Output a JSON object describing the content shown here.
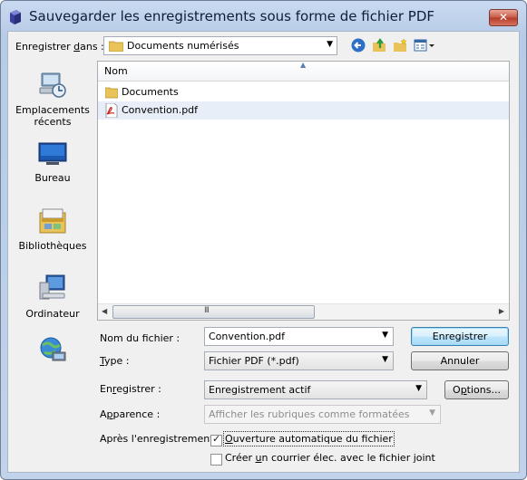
{
  "window": {
    "title": "Sauvegarder les enregistrements sous forme de fichier PDF",
    "close_glyph": "✕"
  },
  "toolbar": {
    "save_in_label_prefix": "Enregistrer ",
    "save_in_label_key": "d",
    "save_in_label_suffix": "ans :",
    "location": "Documents numérisés",
    "icons": [
      "back-icon",
      "up-folder-icon",
      "new-folder-icon",
      "view-menu-icon"
    ]
  },
  "places": [
    {
      "name": "recent-places",
      "label": "Emplacements récents"
    },
    {
      "name": "desktop",
      "label": "Bureau"
    },
    {
      "name": "libraries",
      "label": "Bibliothèques"
    },
    {
      "name": "computer",
      "label": "Ordinateur"
    },
    {
      "name": "network",
      "label": ""
    }
  ],
  "file_list": {
    "column_header": "Nom",
    "items": [
      {
        "name": "Documents",
        "type": "folder",
        "selected": false
      },
      {
        "name": "Convention.pdf",
        "type": "pdf",
        "selected": true
      }
    ],
    "scroll_grip": "III"
  },
  "form": {
    "filename_label": "Nom du fichier :",
    "filename_value": "Convention.pdf",
    "type_label_key": "T",
    "type_label_rest": "ype :",
    "type_value": "Fichier PDF (*.pdf)",
    "record_label_prefix": "En",
    "record_label_key": "r",
    "record_label_suffix": "egistrer :",
    "record_value": "Enregistrement actif",
    "appearance_label_prefix": "A",
    "appearance_label_key": "p",
    "appearance_label_suffix": "parence :",
    "appearance_value": "Afficher les rubriques comme formatées",
    "after_save_label": "Après l'enregistrement :",
    "open_auto_key": "O",
    "open_auto_rest": "uverture automatique du fichier",
    "open_auto_checked": true,
    "email_prefix": "Créer ",
    "email_key": "u",
    "email_suffix": "n courrier élec. avec le fichier joint",
    "email_checked": false
  },
  "buttons": {
    "save": "Enregistrer",
    "cancel": "Annuler",
    "options_prefix": "O",
    "options_key": "p",
    "options_suffix": "tions..."
  },
  "colors": {
    "frame": "#c1d3ea",
    "close": "#c75745",
    "selection": "#e8eef7"
  }
}
